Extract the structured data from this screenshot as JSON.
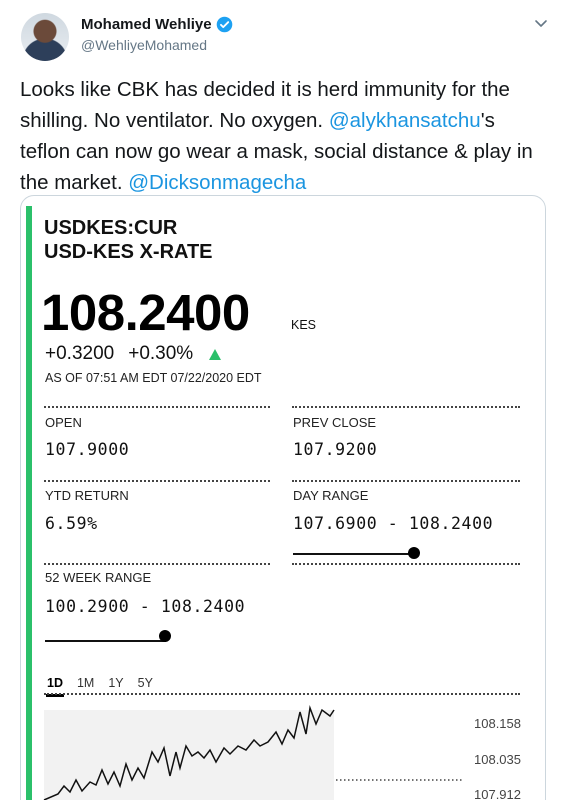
{
  "tweet": {
    "author_name": "Mohamed Wehliye",
    "handle": "@WehliyeMohamed",
    "text_part1": "Looks like CBK has decided it is herd immunity for the shilling. No ventilator. No oxygen. ",
    "mention1": "@alykhansatchu",
    "text_part2": "'s teflon can now go wear a mask, social distance & play in the market.  ",
    "mention2": "@Dicksonmagecha"
  },
  "quote": {
    "ticker": "USDKES:CUR",
    "subtitle": "USD-KES X-RATE",
    "price": "108.2400",
    "currency": "KES",
    "change_abs": "+0.3200",
    "change_pct": "+0.30%",
    "as_of": "AS OF 07:51 AM EDT 07/22/2020 EDT",
    "open_label": "OPEN",
    "open_value": "107.9000",
    "prev_close_label": "PREV CLOSE",
    "prev_close_value": "107.9200",
    "ytd_label": "YTD RETURN",
    "ytd_value": "6.59%",
    "day_range_label": "DAY RANGE",
    "day_range_value": "107.6900  -  108.2400",
    "week52_label": "52 WEEK RANGE",
    "week52_value": "100.2900  -  108.2400",
    "day_range_position": 0.99,
    "week52_position": 0.99
  },
  "chart": {
    "tabs": [
      "1D",
      "1M",
      "1Y",
      "5Y"
    ],
    "active_tab": "1D",
    "y_ticks": [
      "108.158",
      "108.035",
      "107.912"
    ]
  },
  "colors": {
    "accent_green": "#2bc06a",
    "mention_blue": "#1b95e0",
    "verified_blue": "#1da1f2"
  }
}
